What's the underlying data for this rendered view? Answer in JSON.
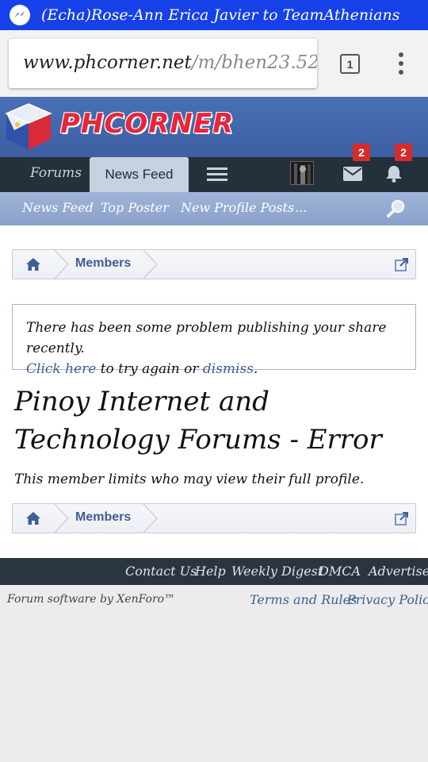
{
  "notification": {
    "text": "(Echa)Rose-Ann Erica Javier to TeamAthenians",
    "icon": "messenger-icon"
  },
  "browser": {
    "url_host": "www.phcorner.net",
    "url_path": "/m/bhen23.52",
    "tab_count": "1"
  },
  "site": {
    "logo_text": "PHCORNER",
    "colors": {
      "header": "#4a6fb5",
      "navbar": "#24303b",
      "link": "#3f5e93",
      "badge": "#d62b2b"
    }
  },
  "nav": {
    "tabs": [
      {
        "label": "Forums"
      },
      {
        "label": "News Feed",
        "selected": true
      }
    ],
    "inbox_count": "2",
    "alerts_count": "2"
  },
  "subnav": {
    "items": [
      {
        "label": "News Feed"
      },
      {
        "label": "Top Poster"
      },
      {
        "label": "New Profile Posts"
      },
      {
        "label": "..."
      }
    ]
  },
  "breadcrumb": {
    "label": "Members"
  },
  "notice": {
    "line1": "There has been some problem publishing your share recently.",
    "click_here": "Click here",
    "mid": " to try again or ",
    "dismiss": "dismiss",
    "end": "."
  },
  "title": "Pinoy Internet and Technology Forums - Error",
  "error_message": "This member limits who may view their full profile.",
  "footer": {
    "links": [
      "Contact Us",
      "Help",
      "Weekly Digest",
      "DMCA",
      "Advertise"
    ],
    "credit": "Forum software by XenForo™",
    "bottom_links": [
      "Terms and Rules",
      "Privacy Policy"
    ]
  }
}
